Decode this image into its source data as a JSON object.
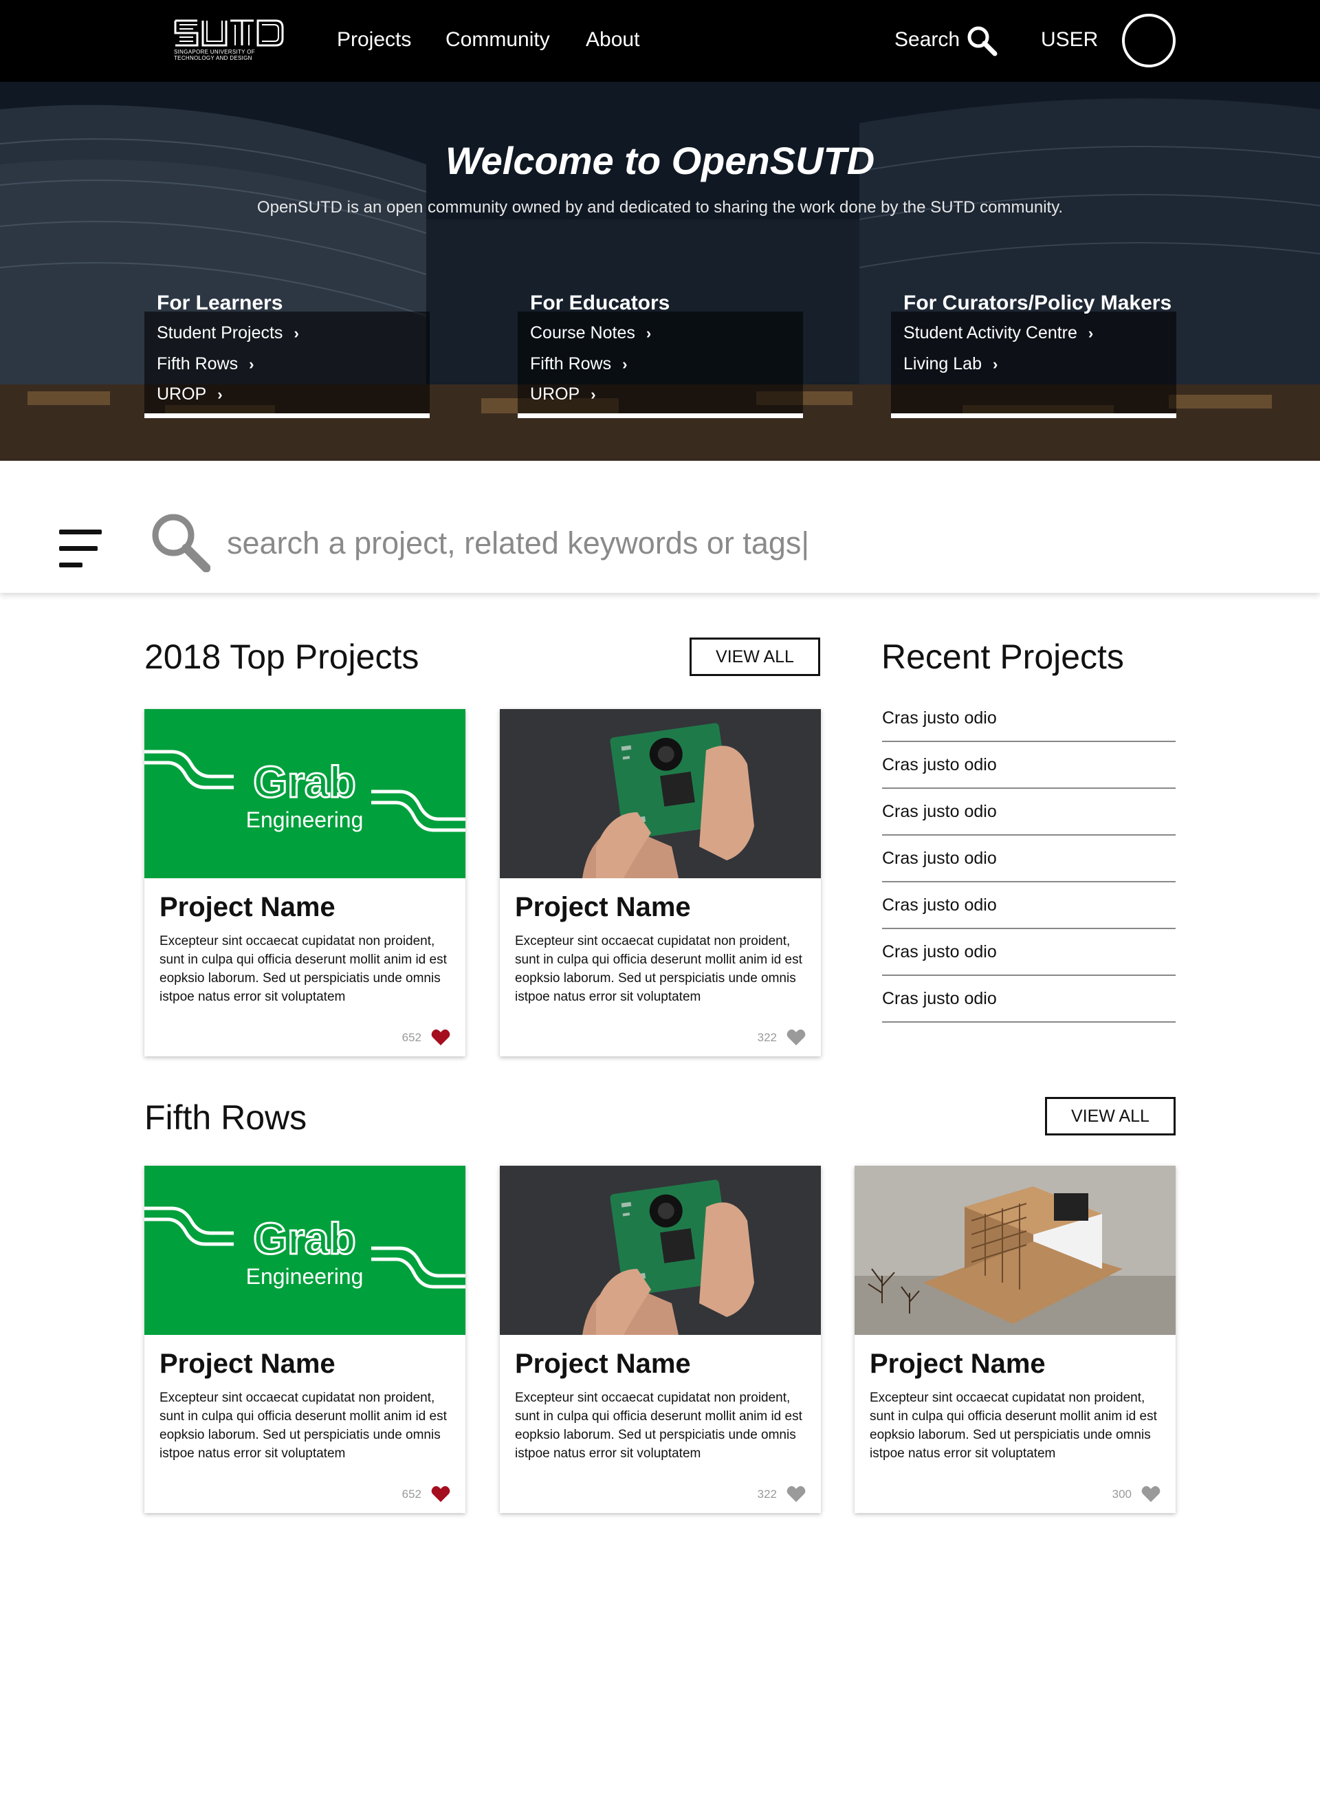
{
  "header": {
    "logo_text": "SUTD",
    "logo_subtitle": "Singapore University of Technology and Design",
    "nav": [
      "Projects",
      "Community",
      "About"
    ],
    "search_label": "Search",
    "user_label": "USER"
  },
  "hero": {
    "title": "Welcome to OpenSUTD",
    "subtitle": "OpenSUTD is an open community owned by and dedicated to sharing the work done by the SUTD community.",
    "audiences": [
      {
        "heading": "For Learners",
        "links": [
          "Student Projects",
          "Fifth Rows",
          "UROP"
        ]
      },
      {
        "heading": "For Educators",
        "links": [
          "Course Notes",
          "Fifth Rows",
          "UROP"
        ]
      },
      {
        "heading": "For Curators/Policy Makers",
        "links": [
          "Student Activity Centre",
          "Living Lab"
        ]
      }
    ],
    "chevron": "›"
  },
  "search": {
    "placeholder": "search a project, related keywords or tags|"
  },
  "top_projects": {
    "title": "2018 Top Projects",
    "view_all": "VIEW ALL",
    "cards": [
      {
        "image": "grab-engineering",
        "image_text_1": "Grab",
        "image_text_2": "Engineering",
        "name": "Project Name",
        "description": "Excepteur sint occaecat cupidatat non proident, sunt in culpa qui officia deserunt mollit anim id est eopksio laborum. Sed ut perspiciatis unde omnis istpoe natus error sit voluptatem",
        "likes": "652",
        "liked": true
      },
      {
        "image": "circuit-board-camera",
        "name": "Project Name",
        "description": "Excepteur sint occaecat cupidatat non proident, sunt in culpa qui officia deserunt mollit anim id est eopksio laborum. Sed ut perspiciatis unde omnis istpoe natus error sit voluptatem",
        "likes": "322",
        "liked": false
      }
    ]
  },
  "recent_projects": {
    "title": "Recent Projects",
    "items": [
      "Cras justo odio",
      "Cras justo odio",
      "Cras justo odio",
      "Cras justo odio",
      "Cras justo odio",
      "Cras justo odio",
      "Cras justo odio"
    ]
  },
  "fifth_rows": {
    "title": "Fifth Rows",
    "view_all": "VIEW ALL",
    "cards": [
      {
        "image": "grab-engineering",
        "image_text_1": "Grab",
        "image_text_2": "Engineering",
        "name": "Project Name",
        "description": "Excepteur sint occaecat cupidatat non proident, sunt in culpa qui officia deserunt mollit anim id est eopksio laborum. Sed ut perspiciatis unde omnis istpoe natus error sit voluptatem",
        "likes": "652",
        "liked": true
      },
      {
        "image": "circuit-board-camera",
        "name": "Project Name",
        "description": "Excepteur sint occaecat cupidatat non proident, sunt in culpa qui officia deserunt mollit anim id est eopksio laborum. Sed ut perspiciatis unde omnis istpoe natus error sit voluptatem",
        "likes": "322",
        "liked": false
      },
      {
        "image": "architecture-model",
        "name": "Project Name",
        "description": "Excepteur sint occaecat cupidatat non proident, sunt in culpa qui officia deserunt mollit anim id est eopksio laborum. Sed ut perspiciatis unde omnis istpoe natus error sit voluptatem",
        "likes": "300",
        "liked": false
      }
    ]
  },
  "colors": {
    "nav_bg": "#000000",
    "grab_green": "#00a03c",
    "heart_liked": "#a50e1e",
    "heart_default": "#9a9a9a"
  }
}
